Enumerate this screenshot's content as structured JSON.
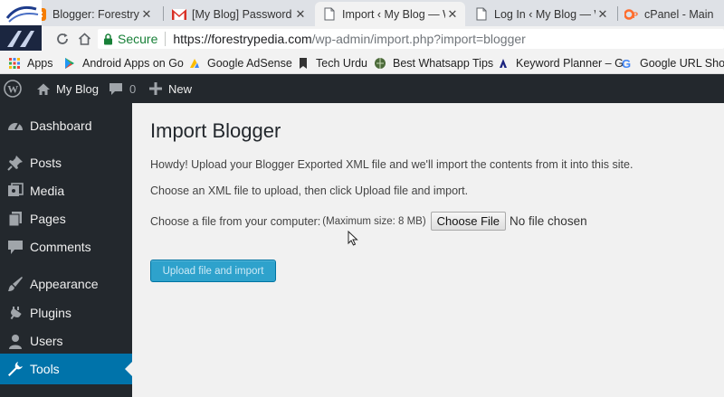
{
  "browser": {
    "tabs": [
      {
        "title": "Blogger: Forestrypedia",
        "icon": "blogger-icon",
        "active": false
      },
      {
        "title": "[My Blog] Password Re",
        "icon": "gmail-icon",
        "active": false
      },
      {
        "title": "Import ‹ My Blog — Wo",
        "icon": "document-icon",
        "active": true
      },
      {
        "title": "Log In ‹ My Blog — Wo",
        "icon": "document-icon",
        "active": false
      },
      {
        "title": "cPanel - Main",
        "icon": "cpanel-icon",
        "active": false
      }
    ],
    "address": {
      "secure_label": "Secure",
      "url_host": "https://forestrypedia.com",
      "url_path": "/wp-admin/import.php?import=blogger"
    },
    "bookmarks": [
      {
        "label": "Apps",
        "icon": "apps-grid-icon"
      },
      {
        "label": "Android Apps on Go",
        "icon": "play-store-icon"
      },
      {
        "label": "Google AdSense",
        "icon": "adsense-icon"
      },
      {
        "label": "Tech Urdu",
        "icon": "bookmark-icon"
      },
      {
        "label": "Best Whatsapp Tips",
        "icon": "globe-icon"
      },
      {
        "label": "Keyword Planner – G",
        "icon": "google-ads-icon"
      },
      {
        "label": "Google URL Shorte",
        "icon": "google-icon"
      }
    ]
  },
  "adminbar": {
    "site_name": "My Blog",
    "comments_count": "0",
    "new_label": "New"
  },
  "sidebar": {
    "items": [
      {
        "label": "Dashboard",
        "icon": "dashboard-icon"
      },
      {
        "label": "Posts",
        "icon": "pin-icon"
      },
      {
        "label": "Media",
        "icon": "media-icon"
      },
      {
        "label": "Pages",
        "icon": "pages-icon"
      },
      {
        "label": "Comments",
        "icon": "comment-icon"
      },
      {
        "label": "Appearance",
        "icon": "brush-icon"
      },
      {
        "label": "Plugins",
        "icon": "plugin-icon"
      },
      {
        "label": "Users",
        "icon": "users-icon"
      },
      {
        "label": "Tools",
        "icon": "wrench-icon",
        "current": true
      }
    ]
  },
  "main": {
    "title": "Import Blogger",
    "intro": "Howdy! Upload your Blogger Exported XML file and we'll import the contents from it into this site.",
    "instructions": "Choose an XML file to upload, then click Upload file and import.",
    "file_label": "Choose a file from your computer:",
    "max_size": "(Maximum size: 8 MB)",
    "choose_button": "Choose File",
    "no_file": "No file chosen",
    "upload_button": "Upload file and import"
  },
  "colors": {
    "admin_dark": "#23282d",
    "accent": "#0073aa",
    "button_primary": "#2ea2cc",
    "content_bg": "#f1f1f1"
  }
}
